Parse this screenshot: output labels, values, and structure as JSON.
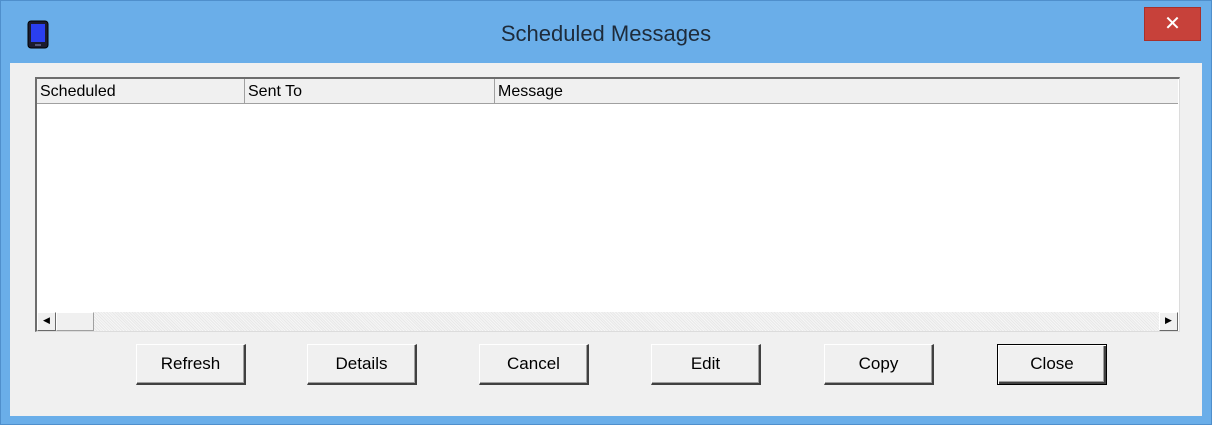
{
  "window": {
    "title": "Scheduled Messages",
    "close_symbol": "✕",
    "app_icon": "phone-icon"
  },
  "listview": {
    "columns": [
      "Scheduled",
      "Sent To",
      "Message"
    ],
    "rows": []
  },
  "scrollbar": {
    "left_arrow": "◀",
    "right_arrow": "▶"
  },
  "buttons": {
    "refresh": "Refresh",
    "details": "Details",
    "cancel": "Cancel",
    "edit": "Edit",
    "copy": "Copy",
    "close": "Close"
  },
  "colors": {
    "titlebar": "#6aaee9",
    "close_button": "#c7413a",
    "dialog_face": "#f0f0f0"
  }
}
